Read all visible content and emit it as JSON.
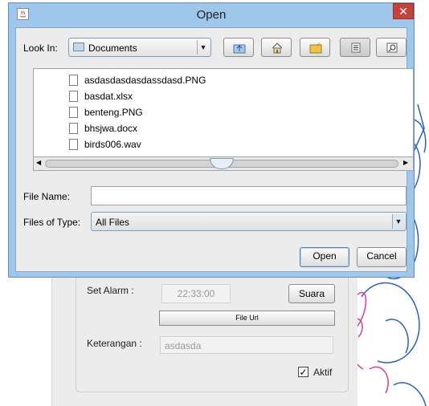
{
  "dialog": {
    "title": "Open",
    "close_symbol": "✕",
    "look_in_label": "Look In:",
    "look_in_value": "Documents",
    "toolbar": [
      "up-folder-icon",
      "home-icon",
      "new-folder-icon",
      "list-view-icon",
      "details-view-icon"
    ],
    "files": [
      {
        "name": "asdasdasdasdassdasd.PNG"
      },
      {
        "name": "basdat.xlsx"
      },
      {
        "name": "benteng.PNG"
      },
      {
        "name": "bhsjwa.docx"
      },
      {
        "name": "birds006.wav"
      }
    ],
    "file_name_label": "File Name:",
    "file_name_value": "",
    "files_of_type_label": "Files of Type:",
    "files_of_type_value": "All Files",
    "open_label": "Open",
    "cancel_label": "Cancel"
  },
  "background_app": {
    "set_alarm_label": "Set Alarm :",
    "alarm_time": "22:33:00",
    "suara_label": "Suara",
    "file_url_label": "File Url",
    "keterangan_label": "Keterangan :",
    "keterangan_value": "asdasda",
    "aktif_label": "Aktif",
    "aktif_checked": true
  },
  "colors": {
    "titlebar": "#9fc7ec",
    "close_button": "#c7423a",
    "sketch_pink": "#d63a9a",
    "sketch_blue": "#2a5fc2"
  }
}
